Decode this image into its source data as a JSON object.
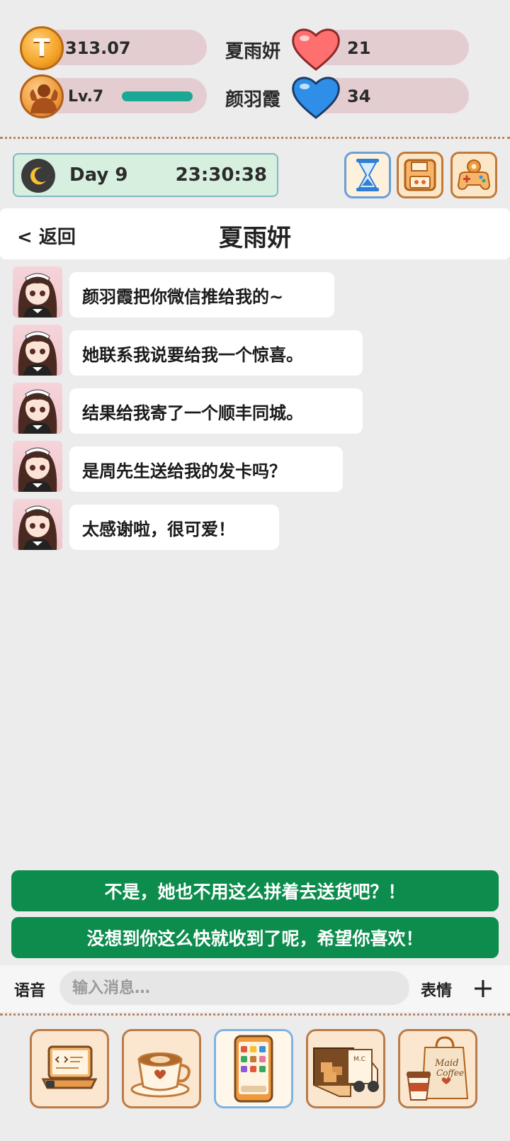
{
  "stats": {
    "coins": "313.07",
    "level": "Lv.7",
    "xp_progress": 0.85,
    "char1_name": "夏雨妍",
    "char1_affection": "21",
    "char2_name": "颜羽霞",
    "char2_affection": "34"
  },
  "clock": {
    "day": "Day 9",
    "time": "23:30:38"
  },
  "chat": {
    "back_label": "< 返回",
    "title": "夏雨妍",
    "messages": [
      "颜羽霞把你微信推给我的~",
      "她联系我说要给我一个惊喜。",
      "结果给我寄了一个顺丰同城。",
      "是周先生送给我的发卡吗？",
      "太感谢啦，很可爱！"
    ]
  },
  "choices": [
    "不是，她也不用这么拼着去送货吧？！",
    "没想到你这么快就收到了呢，希望你喜欢！"
  ],
  "input": {
    "voice_label": "语音",
    "placeholder": "输入消息…",
    "emoji_label": "表情",
    "plus_label": "+"
  },
  "colors": {
    "accent_green": "#0d8d4d",
    "pill_bg": "#e4cdd1",
    "xp_bar": "#1aa895"
  },
  "icons": [
    "coin-icon",
    "muscle-avatar-icon",
    "red-heart-icon",
    "blue-heart-icon",
    "moon-icon",
    "hourglass-icon",
    "save-disk-icon",
    "gamepad-settings-icon",
    "laptop-icon",
    "coffee-cup-icon",
    "phone-icon",
    "delivery-truck-icon",
    "maid-coffee-bag-icon"
  ],
  "dock": {
    "coffee_bag_text_1": "Maid",
    "coffee_bag_text_2": "Coffee",
    "truck_text": "M.C"
  }
}
